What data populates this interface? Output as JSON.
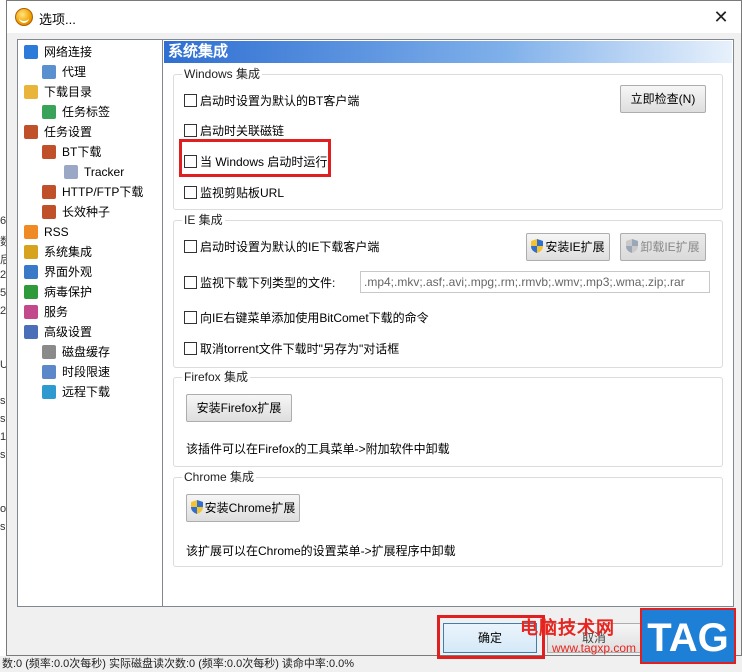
{
  "window": {
    "title": "选项...",
    "close_glyph": "✕"
  },
  "background": {
    "status_text": "数:0 (频率:0.0次每秒) 实际磁盘读次数:0 (频率:0.0次每秒) 读命中率:0.0%",
    "left_chars": [
      "6",
      "数",
      "后",
      "2",
      "58",
      "21",
      "",
      "",
      "U",
      "",
      "s",
      "s",
      "13",
      "s",
      "",
      "",
      "o",
      "s"
    ]
  },
  "tree": {
    "items": [
      {
        "label": "网络连接",
        "icon": "globe-icon",
        "color": "#2c7bd8"
      },
      {
        "label": "代理",
        "icon": "proxy-icon",
        "color": "#5a8fd0"
      },
      {
        "label": "下载目录",
        "icon": "folder-icon",
        "color": "#e8b53a"
      },
      {
        "label": "任务标签",
        "icon": "tag-icon",
        "color": "#3aa35a"
      },
      {
        "label": "任务设置",
        "icon": "clipboard-icon",
        "color": "#c0502a"
      },
      {
        "label": "BT下载",
        "icon": "clipboard-icon",
        "color": "#c0502a"
      },
      {
        "label": "Tracker",
        "icon": "server-icon",
        "color": "#9aa7c5"
      },
      {
        "label": "HTTP/FTP下载",
        "icon": "clipboard-icon",
        "color": "#c0502a"
      },
      {
        "label": "长效种子",
        "icon": "clipboard-icon",
        "color": "#c0502a"
      },
      {
        "label": "RSS",
        "icon": "rss-icon",
        "color": "#f08a24"
      },
      {
        "label": "系统集成",
        "icon": "integration-icon",
        "color": "#d7a21e"
      },
      {
        "label": "界面外观",
        "icon": "palette-icon",
        "color": "#3a78c8"
      },
      {
        "label": "病毒保护",
        "icon": "shield-icon",
        "color": "#2e9a3a"
      },
      {
        "label": "服务",
        "icon": "users-icon",
        "color": "#c24a8a"
      },
      {
        "label": "高级设置",
        "icon": "advanced-icon",
        "color": "#4a6fb8"
      },
      {
        "label": "磁盘缓存",
        "icon": "disk-icon",
        "color": "#8a8a8a"
      },
      {
        "label": "时段限速",
        "icon": "speed-icon",
        "color": "#5a88c8"
      },
      {
        "label": "远程下载",
        "icon": "remote-icon",
        "color": "#2f9ad0"
      }
    ]
  },
  "panel": {
    "header": "系统集成",
    "windows_group": {
      "title": "Windows 集成",
      "opt_default_bt": "启动时设置为默认的BT客户端",
      "opt_magnet": "启动时关联磁链",
      "opt_startup": "当 Windows 启动时运行",
      "opt_clipboard": "监视剪贴板URL",
      "check_now": "立即检查(N)"
    },
    "ie_group": {
      "title": "IE 集成",
      "opt_default_ie": "启动时设置为默认的IE下载客户端",
      "opt_monitor_types": "监视下载下列类型的文件:",
      "file_types": ".mp4;.mkv;.asf;.avi;.mpg;.rm;.rmvb;.wmv;.mp3;.wma;.zip;.rar",
      "opt_context_menu": "向IE右键菜单添加使用BitComet下载的命令",
      "opt_cancel_torrent": "取消torrent文件下载时\"另存为\"对话框",
      "install_ie": "安装IE扩展",
      "uninstall_ie": "卸载IE扩展"
    },
    "firefox_group": {
      "title": "Firefox 集成",
      "install": "安装Firefox扩展",
      "note": "该插件可以在Firefox的工具菜单->附加软件中卸载"
    },
    "chrome_group": {
      "title": "Chrome 集成",
      "install": "安装Chrome扩展",
      "note": "该扩展可以在Chrome的设置菜单->扩展程序中卸载"
    }
  },
  "footer": {
    "ok": "确定",
    "cancel": "取消"
  },
  "watermark": {
    "site_name": "电脑技术网",
    "url": "www.tagxp.com",
    "tag": "TAG"
  },
  "colors": {
    "highlight": "#e02020",
    "header_blue": "#2f6fd2"
  }
}
